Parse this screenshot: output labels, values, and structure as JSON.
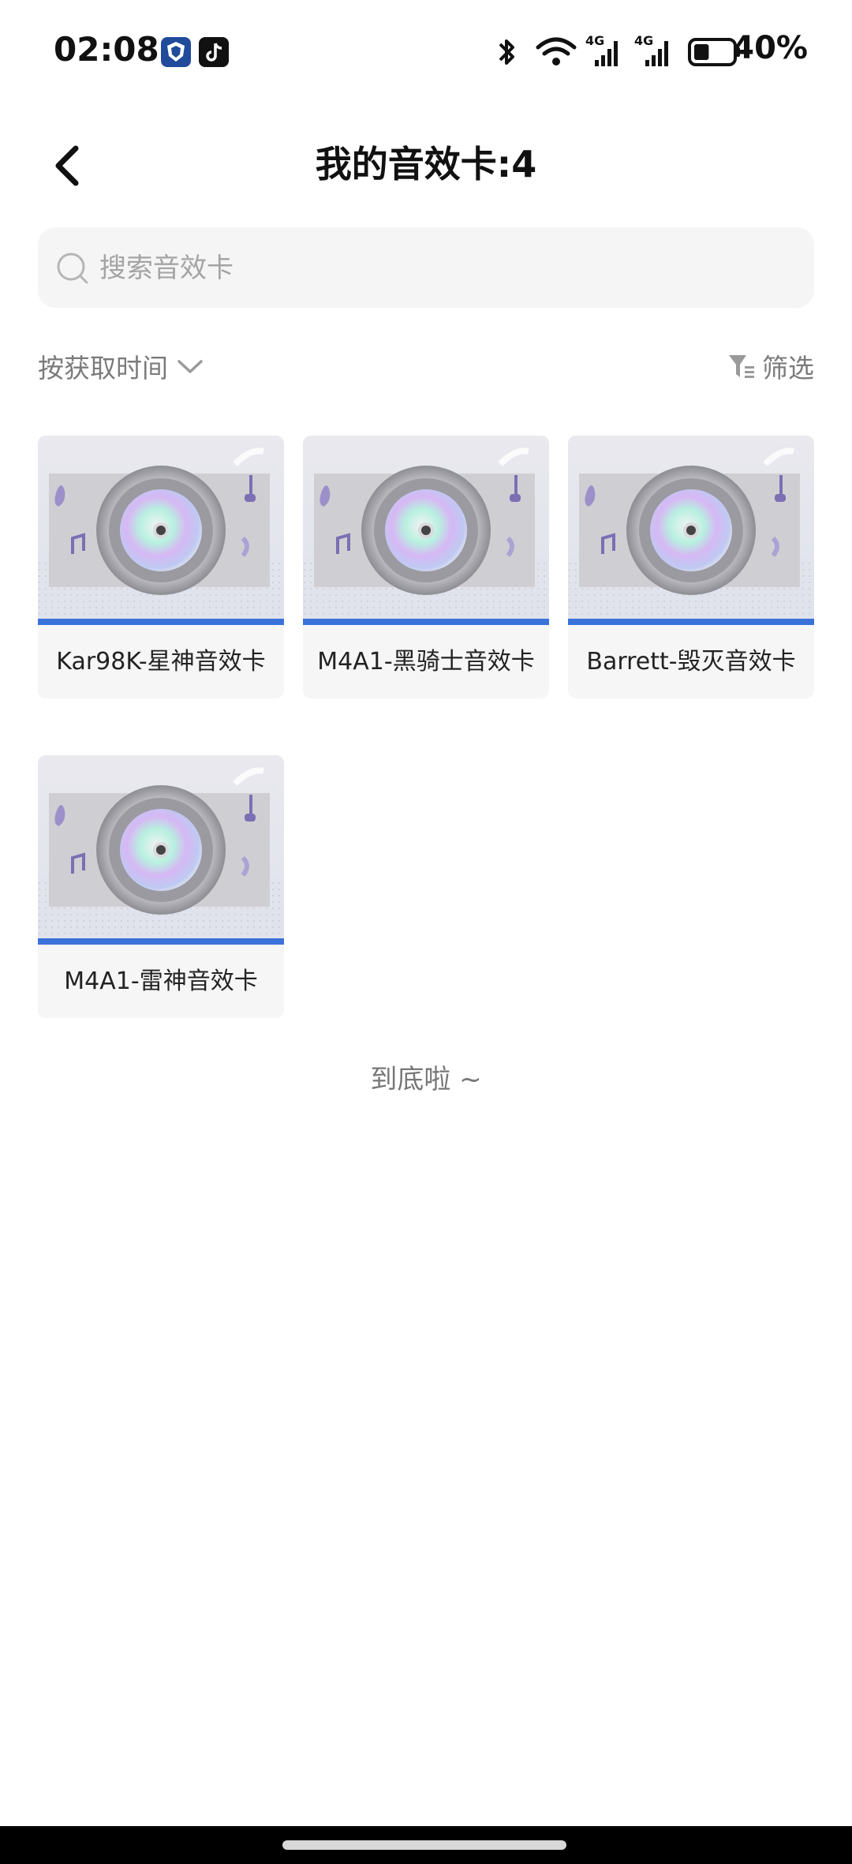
{
  "status_bar": {
    "time": "02:08",
    "battery": "40%",
    "left_icons": [
      "app-shield-icon",
      "tiktok-icon"
    ],
    "right_icons": [
      "bluetooth-icon",
      "wifi-icon",
      "signal-4g-icon",
      "signal-4g-icon",
      "battery-icon"
    ],
    "network_label": "4G",
    "battery_level": 0.4
  },
  "header": {
    "title": "我的音效卡:4",
    "back_icon": "chevron-left-icon"
  },
  "search": {
    "placeholder": "搜索音效卡",
    "value": ""
  },
  "sort": {
    "label": "按获取时间",
    "icon": "chevron-down-icon"
  },
  "filter": {
    "label": "筛选",
    "icon": "filter-icon"
  },
  "cards": [
    {
      "label": "Kar98K-星神音效卡",
      "image": "sound-card-disc-image"
    },
    {
      "label": "M4A1-黑骑士音效卡",
      "image": "sound-card-disc-image"
    },
    {
      "label": "Barrett-毁灭音效卡",
      "image": "sound-card-disc-image"
    },
    {
      "label": "M4A1-雷神音效卡",
      "image": "sound-card-disc-image"
    }
  ],
  "footer": {
    "end_text": "到底啦 ~"
  },
  "colors": {
    "accent_blue": "#3b72d9",
    "card_bg": "#f6f6f6",
    "search_bg": "#f5f5f5"
  }
}
